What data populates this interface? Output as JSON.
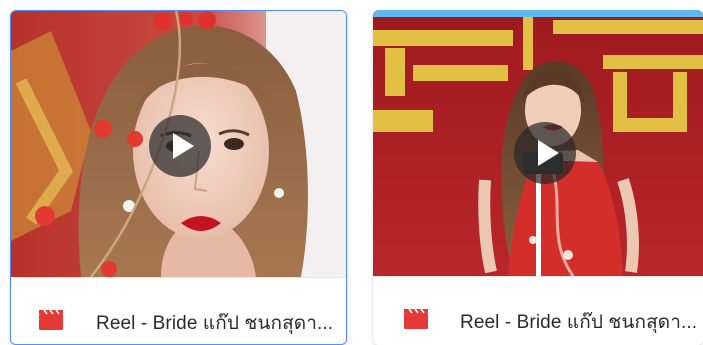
{
  "cards": [
    {
      "title": "Reel - Bride แก๊ป ชนกสุดา...",
      "icon": "clapperboard-icon",
      "thumbnail": "woman-red-lips-flower-hairpin",
      "has_play_button": true
    },
    {
      "title": "Reel - Bride แก๊ป ชนกสุดา...",
      "icon": "clapperboard-icon",
      "thumbnail": "woman-red-dress-holding-sign",
      "has_play_button": true
    }
  ],
  "colors": {
    "icon_red": "#e53935",
    "selected_border": "#4d90fe",
    "top_bar": "#5fb9ef",
    "title_text": "#2b2b2b"
  }
}
